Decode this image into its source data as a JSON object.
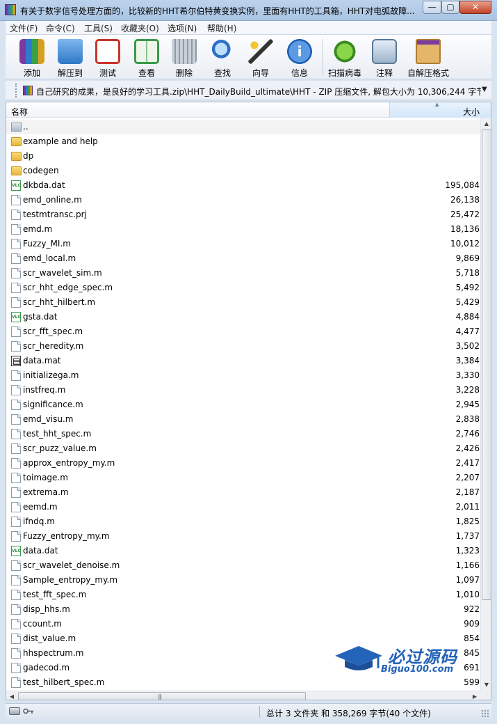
{
  "window": {
    "title": "有关于数字信号处理方面的，比较新的HHT希尔伯特黄变换实例，里面有HHT的工具箱，HHT对电弧故障...",
    "min_label": "—",
    "max_label": "▢",
    "close_label": "✕"
  },
  "menu": [
    "文件(F)",
    "命令(C)",
    "工具(S)",
    "收藏夹(O)",
    "选项(N)",
    "帮助(H)"
  ],
  "toolbar": {
    "buttons": [
      {
        "label": "添加",
        "icon": "add-archive-icon",
        "color": "#8a4fb0"
      },
      {
        "label": "解压到",
        "icon": "extract-folder-icon",
        "color": "#4a90d9"
      },
      {
        "label": "测试",
        "icon": "test-clipboard-icon",
        "color": "#d94a3a"
      },
      {
        "label": "查看",
        "icon": "view-book-icon",
        "color": "#3aa04a"
      },
      {
        "label": "删除",
        "icon": "trash-icon",
        "color": "#8e99a6"
      },
      {
        "label": "查找",
        "icon": "search-icon",
        "color": "#3a7ad0"
      },
      {
        "label": "向导",
        "icon": "wizard-wand-icon",
        "color": "#c9a030"
      },
      {
        "label": "信息",
        "icon": "info-icon",
        "color": "#2f6fc8"
      },
      {
        "label": "扫描病毒",
        "icon": "virus-scan-icon",
        "color": "#58b030"
      },
      {
        "label": "注释",
        "icon": "comment-icon",
        "color": "#6c8cb0"
      },
      {
        "label": "自解压格式",
        "icon": "sfx-box-icon",
        "color": "#d88a3a"
      }
    ]
  },
  "address": {
    "path": "自己研究的成果，是良好的学习工具.zip\\HHT_DailyBuild_ultimate\\HHT - ZIP 压缩文件, 解包大小为 10,306,244 字节",
    "dropdown_icon": "▼"
  },
  "columns": {
    "name": "名称",
    "size": "大小",
    "sort_icon": "▲"
  },
  "files": [
    {
      "name": "..",
      "size": "",
      "type": "updir"
    },
    {
      "name": "example and help",
      "size": "",
      "type": "folder"
    },
    {
      "name": "dp",
      "size": "",
      "type": "folder"
    },
    {
      "name": "codegen",
      "size": "",
      "type": "folder"
    },
    {
      "name": "dkbda.dat",
      "size": "195,084",
      "type": "vlc"
    },
    {
      "name": "emd_online.m",
      "size": "26,138",
      "type": "doc"
    },
    {
      "name": "testmtransc.prj",
      "size": "25,472",
      "type": "doc"
    },
    {
      "name": "emd.m",
      "size": "18,136",
      "type": "doc"
    },
    {
      "name": "Fuzzy_MI.m",
      "size": "10,012",
      "type": "doc"
    },
    {
      "name": "emd_local.m",
      "size": "9,869",
      "type": "doc"
    },
    {
      "name": "scr_wavelet_sim.m",
      "size": "5,718",
      "type": "doc"
    },
    {
      "name": "scr_hht_edge_spec.m",
      "size": "5,492",
      "type": "doc"
    },
    {
      "name": "scr_hht_hilbert.m",
      "size": "5,429",
      "type": "doc"
    },
    {
      "name": "gsta.dat",
      "size": "4,884",
      "type": "vlc"
    },
    {
      "name": "scr_fft_spec.m",
      "size": "4,477",
      "type": "doc"
    },
    {
      "name": "scr_heredity.m",
      "size": "3,502",
      "type": "doc"
    },
    {
      "name": "data.mat",
      "size": "3,384",
      "type": "mat"
    },
    {
      "name": "initializega.m",
      "size": "3,330",
      "type": "doc"
    },
    {
      "name": "instfreq.m",
      "size": "3,228",
      "type": "doc"
    },
    {
      "name": "significance.m",
      "size": "2,945",
      "type": "doc"
    },
    {
      "name": "emd_visu.m",
      "size": "2,838",
      "type": "doc"
    },
    {
      "name": "test_hht_spec.m",
      "size": "2,746",
      "type": "doc"
    },
    {
      "name": "scr_puzz_value.m",
      "size": "2,426",
      "type": "doc"
    },
    {
      "name": "approx_entropy_my.m",
      "size": "2,417",
      "type": "doc"
    },
    {
      "name": "toimage.m",
      "size": "2,207",
      "type": "doc"
    },
    {
      "name": "extrema.m",
      "size": "2,187",
      "type": "doc"
    },
    {
      "name": "eemd.m",
      "size": "2,011",
      "type": "doc"
    },
    {
      "name": "ifndq.m",
      "size": "1,825",
      "type": "doc"
    },
    {
      "name": "Fuzzy_entropy_my.m",
      "size": "1,737",
      "type": "doc"
    },
    {
      "name": "data.dat",
      "size": "1,323",
      "type": "vlc"
    },
    {
      "name": "scr_wavelet_denoise.m",
      "size": "1,166",
      "type": "doc"
    },
    {
      "name": "Sample_entropy_my.m",
      "size": "1,097",
      "type": "doc"
    },
    {
      "name": "test_fft_spec.m",
      "size": "1,010",
      "type": "doc"
    },
    {
      "name": "disp_hhs.m",
      "size": "922",
      "type": "doc"
    },
    {
      "name": "ccount.m",
      "size": "909",
      "type": "doc"
    },
    {
      "name": "dist_value.m",
      "size": "854",
      "type": "doc"
    },
    {
      "name": "hhspectrum.m",
      "size": "845",
      "type": "doc"
    },
    {
      "name": "gadecod.m",
      "size": "691",
      "type": "doc"
    },
    {
      "name": "test_hilbert_spec.m",
      "size": "599",
      "type": "doc"
    }
  ],
  "scroll": {
    "up": "▲",
    "down": "▼",
    "left": "◀",
    "right": "▶",
    "grip": "|||"
  },
  "watermark": {
    "title": "必过源码",
    "url": "Biguo100.com",
    "color": "#2363b8"
  },
  "status": {
    "text": "总计 3 文件夹 和 358,269 字节(40 个文件)"
  }
}
